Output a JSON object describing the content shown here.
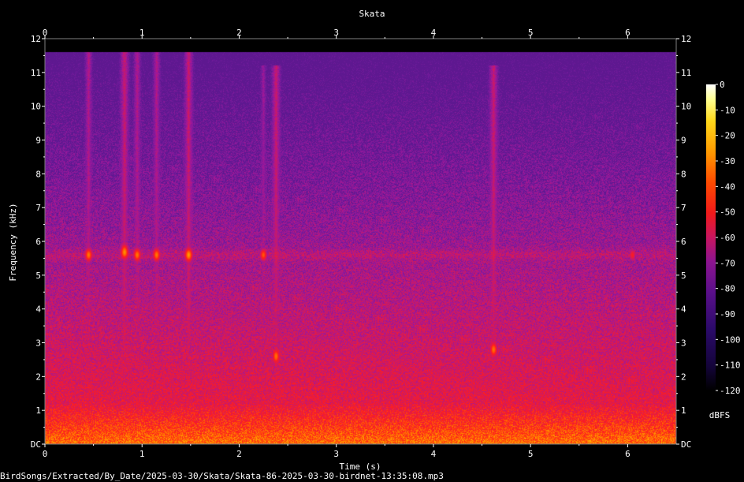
{
  "chart_data": {
    "type": "heatmap",
    "title": "Skata",
    "xlabel": "Time (s)",
    "ylabel": "Frequency (kHz)",
    "xlim": [
      0,
      6.5
    ],
    "ylim": [
      0,
      12
    ],
    "x_ticks": [
      "0",
      "1",
      "2",
      "3",
      "4",
      "5",
      "6"
    ],
    "y_ticks": [
      "DC",
      "1",
      "2",
      "3",
      "4",
      "5",
      "6",
      "7",
      "8",
      "9",
      "10",
      "11",
      "12"
    ],
    "colorbar": {
      "unit": "dBFS",
      "range": [
        -120,
        0
      ],
      "ticks": [
        "0",
        "-10",
        "-20",
        "-30",
        "-40",
        "-50",
        "-60",
        "-70",
        "-80",
        "-90",
        "-100",
        "-110",
        "-120"
      ]
    },
    "energy_cutoff_khz": 11.6,
    "colormap": [
      "#000000",
      "#1a0540",
      "#3b0f70",
      "#6a1b9a",
      "#a0189a",
      "#d81a56",
      "#ff1d1d",
      "#ff6a00",
      "#ffc200",
      "#ffff80",
      "#ffffff"
    ],
    "events": [
      {
        "time_s": 0.45,
        "freq_khz": [
          1.0,
          11.6
        ],
        "peak_khz": 5.6,
        "level_dbfs": -40
      },
      {
        "time_s": 0.82,
        "freq_khz": [
          1.0,
          11.6
        ],
        "peak_khz": 5.7,
        "level_dbfs": -35
      },
      {
        "time_s": 0.95,
        "freq_khz": [
          1.0,
          11.6
        ],
        "peak_khz": 5.6,
        "level_dbfs": -40
      },
      {
        "time_s": 1.15,
        "freq_khz": [
          1.0,
          11.6
        ],
        "peak_khz": 5.6,
        "level_dbfs": -40
      },
      {
        "time_s": 1.48,
        "freq_khz": [
          1.0,
          11.6
        ],
        "peak_khz": 5.6,
        "level_dbfs": -35
      },
      {
        "time_s": 2.25,
        "freq_khz": [
          1.0,
          11.2
        ],
        "peak_khz": 5.6,
        "level_dbfs": -45
      },
      {
        "time_s": 2.38,
        "freq_khz": [
          1.6,
          11.2
        ],
        "peak_khz": 2.6,
        "level_dbfs": -35
      },
      {
        "time_s": 4.62,
        "freq_khz": [
          1.6,
          11.2
        ],
        "peak_khz": 2.8,
        "level_dbfs": -35
      },
      {
        "time_s": 6.05,
        "freq_khz": [
          4.8,
          6.0
        ],
        "peak_khz": 5.6,
        "level_dbfs": -55
      }
    ]
  },
  "footer": {
    "path": "BirdSongs/Extracted/By_Date/2025-03-30/Skata/Skata-86-2025-03-30-birdnet-13:35:08.mp3"
  }
}
